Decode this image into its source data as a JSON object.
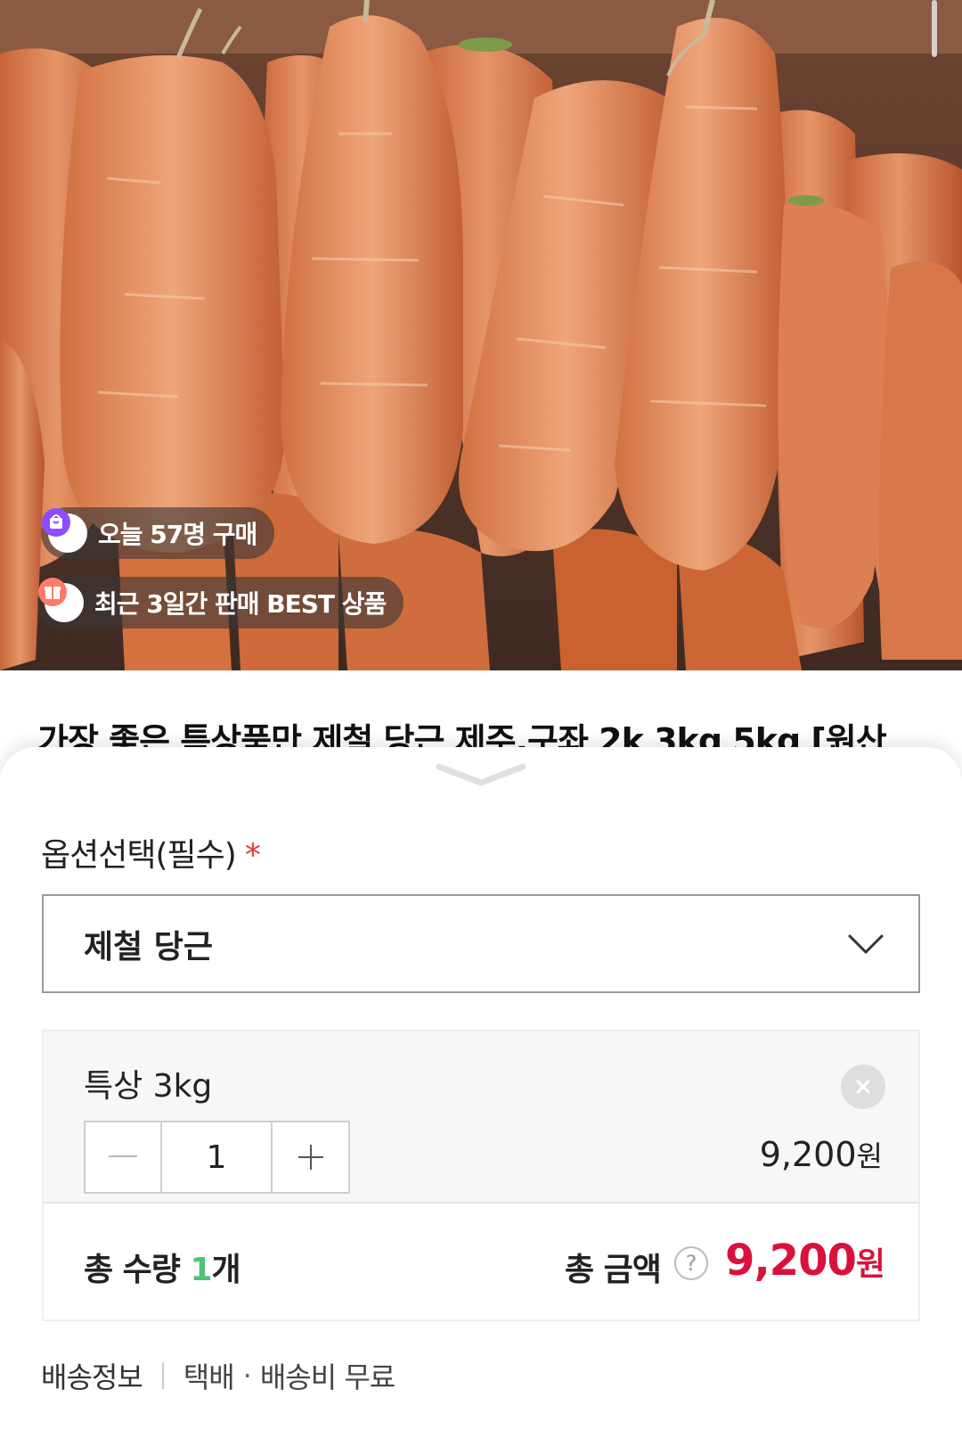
{
  "photo": {
    "alt": "carrots",
    "badges": {
      "today_buyers": "오늘 57명 구매",
      "best_seller": "최근 3일간 판매 BEST 상품"
    }
  },
  "product": {
    "title": "가장 좋은 특상품만 제철 당근 제주,구좌 2k 3kg 5kg [원산"
  },
  "sheet": {
    "option_label": "옵션선택(필수)",
    "required_mark": "*",
    "selected_option": "제철 당근",
    "item": {
      "name": "특상 3kg",
      "quantity": "1",
      "price": "9,200",
      "price_unit": "원"
    },
    "total": {
      "qty_label_prefix": "총 수량 ",
      "qty_value": "1",
      "qty_unit": "개",
      "amount_label": "총 금액",
      "help": "?",
      "amount": "9,200",
      "amount_unit": "원"
    },
    "shipping": {
      "label": "배송정보",
      "method": "택배",
      "dot": "·",
      "fee": "배송비 무료"
    }
  },
  "colors": {
    "accent_red": "#d8123c",
    "qty_green": "#4fc27a",
    "required_red": "#e03a3a"
  }
}
